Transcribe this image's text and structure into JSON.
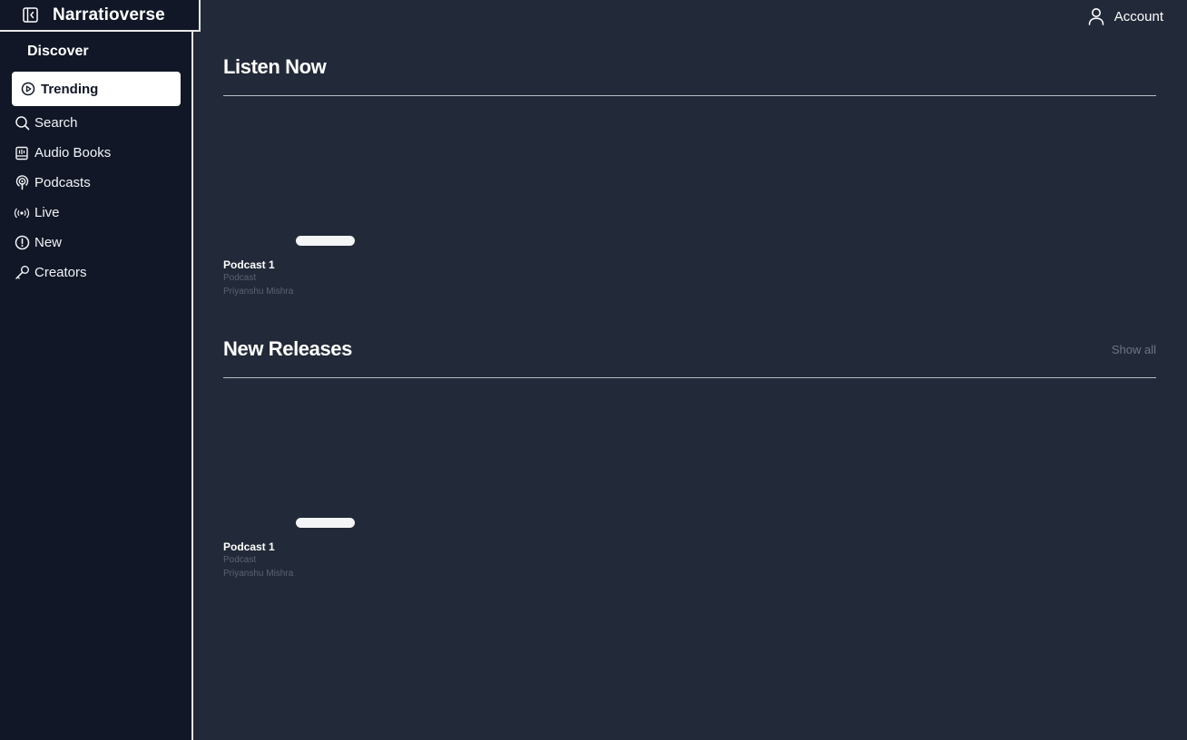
{
  "brand": {
    "title": "Narratioverse",
    "toggle_icon": "sidebar-collapse-icon"
  },
  "sidebar": {
    "section_label": "Discover",
    "items": [
      {
        "label": "Trending",
        "icon": "play-circle-icon",
        "active": true
      },
      {
        "label": "Search",
        "icon": "search-icon",
        "active": false
      },
      {
        "label": "Audio Books",
        "icon": "book-icon",
        "active": false
      },
      {
        "label": "Podcasts",
        "icon": "podcast-icon",
        "active": false
      },
      {
        "label": "Live",
        "icon": "broadcast-icon",
        "active": false
      },
      {
        "label": "New",
        "icon": "alert-circle-icon",
        "active": false
      },
      {
        "label": "Creators",
        "icon": "key-icon",
        "active": false
      }
    ]
  },
  "header": {
    "account_label": "Account",
    "account_icon": "user-icon"
  },
  "sections": {
    "listen_now": {
      "title": "Listen Now",
      "cards": [
        {
          "title": "Podcast 1",
          "type": "Podcast",
          "author": "Priyanshu Mishra"
        }
      ]
    },
    "new_releases": {
      "title": "New Releases",
      "show_all": "Show all",
      "cards": [
        {
          "title": "Podcast 1",
          "type": "Podcast",
          "author": "Priyanshu Mishra"
        }
      ]
    }
  },
  "colors": {
    "background": "#222938",
    "sidebar": "#111726",
    "active_item_bg": "#ffffff",
    "muted_text": "#5b6372",
    "divider": "#b8bcc4"
  }
}
